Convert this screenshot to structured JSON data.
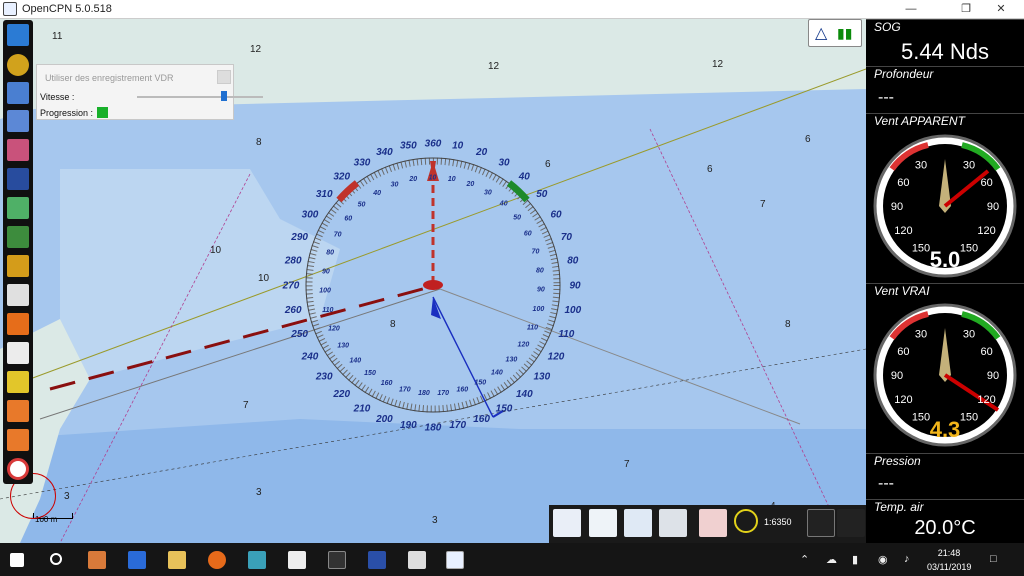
{
  "window": {
    "title": "OpenCPN 5.0.518"
  },
  "vdr": {
    "title": "Utiliser des enregistrement VDR",
    "speed_label": "Vitesse :",
    "progress_label": "Progression :"
  },
  "chart": {
    "depth_labels": [
      "11",
      "12",
      "12",
      "12",
      "8",
      "10",
      "10",
      "8",
      "7",
      "6",
      "6",
      "7",
      "6",
      "8",
      "7",
      "3",
      "3",
      "4",
      "3"
    ],
    "scale_bar": "100 m",
    "scale_text": "1:6350"
  },
  "compass": {
    "outer_labels": [
      "350",
      "360",
      "10",
      "20",
      "30",
      "40",
      "50",
      "60",
      "70",
      "80",
      "90",
      "100",
      "110",
      "120",
      "130",
      "140",
      "150",
      "160",
      "170",
      "180",
      "190",
      "200",
      "210",
      "220",
      "230",
      "240",
      "250",
      "260",
      "270",
      "280",
      "290",
      "300",
      "310",
      "320",
      "330",
      "340"
    ],
    "inner_labels": [
      "10",
      "20",
      "30",
      "40",
      "50",
      "60",
      "70",
      "80",
      "90",
      "100",
      "110",
      "120",
      "130",
      "140",
      "150",
      "160",
      "170",
      "180",
      "170",
      "160",
      "150",
      "140",
      "130",
      "120",
      "110",
      "100",
      "90",
      "80",
      "70",
      "60",
      "50",
      "40",
      "30",
      "20",
      "10"
    ]
  },
  "dash": {
    "sog_label": "SOG",
    "sog_value": "5.44 Nds",
    "depth_label": "Profondeur",
    "depth_value": "---",
    "app_wind_label": "Vent APPARENT",
    "app_wind_value": "5.0",
    "true_wind_label": "Vent VRAI",
    "true_wind_value": "4.3",
    "pressure_label": "Pression",
    "pressure_value": "---",
    "air_temp_label": "Temp. air",
    "air_temp_value": "20.0°C",
    "gauge_ticks": [
      "30",
      "60",
      "90",
      "120",
      "150",
      "150",
      "120",
      "90",
      "60",
      "30"
    ]
  },
  "taskbar": {
    "time": "21:48",
    "date": "03/11/2019"
  },
  "colors": {
    "land": "#dbe9e6",
    "shallow": "#a9c9ee",
    "deep": "#c7dcf3",
    "compass_text": "#1a2f8a",
    "accent_red": "#c0332b",
    "accent_green": "#1e8a2a"
  }
}
